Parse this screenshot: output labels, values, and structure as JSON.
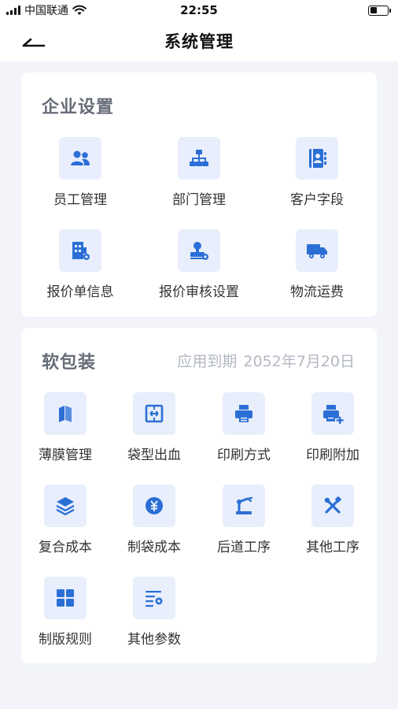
{
  "status_bar": {
    "carrier": "中国联通",
    "time": "22:55"
  },
  "nav": {
    "title": "系统管理"
  },
  "enterprise": {
    "title": "企业设置",
    "items": [
      {
        "label": "员工管理",
        "icon": "users-icon"
      },
      {
        "label": "部门管理",
        "icon": "org-chart-icon"
      },
      {
        "label": "客户字段",
        "icon": "contact-book-icon"
      },
      {
        "label": "报价单信息",
        "icon": "building-gear-icon"
      },
      {
        "label": "报价审核设置",
        "icon": "stamp-gear-icon"
      },
      {
        "label": "物流运费",
        "icon": "truck-icon"
      }
    ]
  },
  "packaging": {
    "title": "软包装",
    "expiry_label": "应用到期",
    "expiry_date": "2052年7月20日",
    "items": [
      {
        "label": "薄膜管理",
        "icon": "film-icon"
      },
      {
        "label": "袋型出血",
        "icon": "bag-bleed-icon"
      },
      {
        "label": "印刷方式",
        "icon": "printer-icon"
      },
      {
        "label": "印刷附加",
        "icon": "printer-plus-icon"
      },
      {
        "label": "复合成本",
        "icon": "layers-icon"
      },
      {
        "label": "制袋成本",
        "icon": "yen-coin-icon"
      },
      {
        "label": "后道工序",
        "icon": "robot-arm-icon"
      },
      {
        "label": "其他工序",
        "icon": "tools-icon"
      },
      {
        "label": "制版规则",
        "icon": "grid-icon"
      },
      {
        "label": "其他参数",
        "icon": "list-gear-icon"
      }
    ]
  },
  "colors": {
    "accent": "#2b6fd6",
    "icon_bg": "#e8eefb",
    "page_bg": "#f2f4f9"
  }
}
